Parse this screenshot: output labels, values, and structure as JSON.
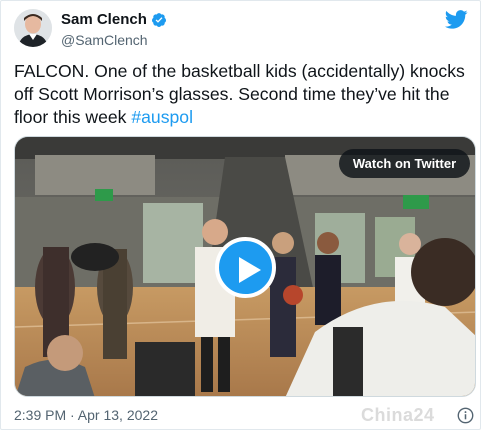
{
  "author": {
    "display_name": "Sam Clench",
    "handle": "@SamClench",
    "verified": true
  },
  "tweet": {
    "text": "FALCON. One of the basketball kids (accidentally) knocks off Scott Morrison’s glasses. Second time they’ve hit the floor this week ",
    "hashtag": "#auspol",
    "timestamp": "2:39 PM · Apr 13, 2022"
  },
  "media": {
    "watch_label": "Watch on Twitter",
    "scene_sign": "EXIT"
  },
  "watermark": "China24",
  "icons": {
    "logo": "twitter-bird-icon",
    "verified": "verified-badge-icon",
    "play": "play-icon",
    "info": "info-icon"
  },
  "colors": {
    "accent": "#1d9bf0",
    "text": "#0f1419",
    "muted": "#536471"
  }
}
